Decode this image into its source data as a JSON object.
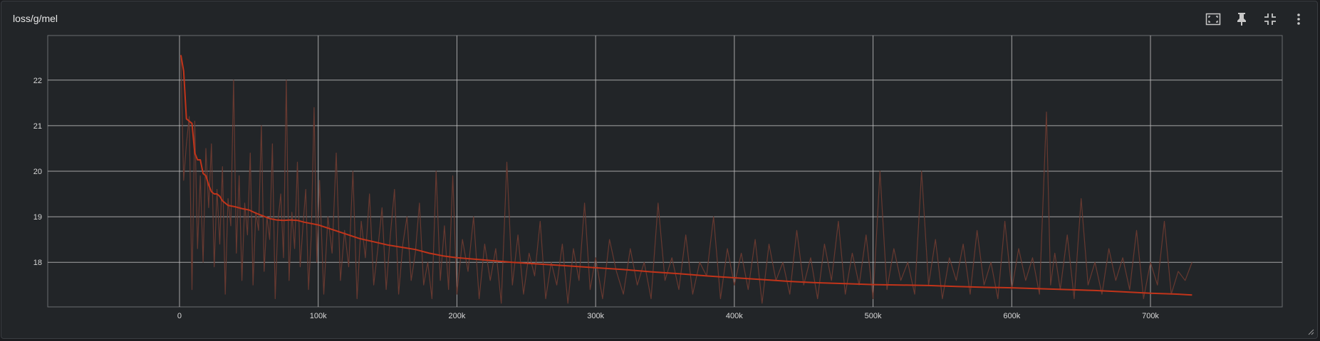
{
  "card": {
    "title": "loss/g/mel"
  },
  "toolbar": [
    {
      "name": "fit-domain-button",
      "icon": "fit-to-data-icon"
    },
    {
      "name": "pin-button",
      "icon": "pin-icon"
    },
    {
      "name": "collapse-button",
      "icon": "collapse-icon"
    },
    {
      "name": "more-options-button",
      "icon": "more-vert-icon"
    }
  ],
  "colors": {
    "background": "#222528",
    "grid": "#bcbcbc",
    "raw_series": "#6b3a30",
    "smoothed_series": "#c2341a",
    "tick_text": "#d8d8d8"
  },
  "chart_data": {
    "type": "line",
    "title": "loss/g/mel",
    "xlabel": "",
    "ylabel": "",
    "xlim": [
      -95000,
      795000
    ],
    "ylim": [
      17.02,
      22.98
    ],
    "x_ticks": [
      0,
      100000,
      200000,
      300000,
      400000,
      500000,
      600000,
      700000
    ],
    "x_tick_labels": [
      "0",
      "100k",
      "200k",
      "300k",
      "400k",
      "500k",
      "600k",
      "700k"
    ],
    "y_ticks": [
      18,
      19,
      20,
      21,
      22
    ],
    "y_tick_labels": [
      "18",
      "19",
      "20",
      "21",
      "22"
    ],
    "grid": true,
    "legend": "none",
    "series": [
      {
        "role": "raw",
        "color": "#6b3a30",
        "x": [
          1000,
          3000,
          5000,
          7000,
          9000,
          11000,
          13000,
          15000,
          17000,
          19000,
          21000,
          23000,
          25000,
          27000,
          29000,
          31000,
          33000,
          35000,
          37000,
          39000,
          41000,
          43000,
          45000,
          47000,
          49000,
          51000,
          53000,
          55000,
          57000,
          59000,
          61000,
          63000,
          65000,
          67000,
          69000,
          71000,
          73000,
          75000,
          77000,
          79000,
          81000,
          83000,
          85000,
          87000,
          89000,
          91000,
          93000,
          95000,
          97000,
          99000,
          101000,
          104000,
          107000,
          110000,
          113000,
          116000,
          119000,
          122000,
          125000,
          128000,
          131000,
          134000,
          137000,
          140000,
          143000,
          146000,
          149000,
          152000,
          155000,
          158000,
          161000,
          164000,
          167000,
          170000,
          173000,
          176000,
          179000,
          182000,
          185000,
          188000,
          191000,
          194000,
          197000,
          200000,
          204000,
          208000,
          212000,
          216000,
          220000,
          224000,
          228000,
          232000,
          236000,
          240000,
          244000,
          248000,
          252000,
          256000,
          260000,
          264000,
          268000,
          272000,
          276000,
          280000,
          284000,
          288000,
          292000,
          296000,
          300000,
          305000,
          310000,
          315000,
          320000,
          325000,
          330000,
          335000,
          340000,
          345000,
          350000,
          355000,
          360000,
          365000,
          370000,
          375000,
          380000,
          385000,
          390000,
          395000,
          400000,
          405000,
          410000,
          415000,
          420000,
          425000,
          430000,
          435000,
          440000,
          445000,
          450000,
          455000,
          460000,
          465000,
          470000,
          475000,
          480000,
          485000,
          490000,
          495000,
          500000,
          505000,
          510000,
          515000,
          520000,
          525000,
          530000,
          535000,
          540000,
          545000,
          550000,
          555000,
          560000,
          565000,
          570000,
          575000,
          580000,
          585000,
          590000,
          595000,
          600000,
          605000,
          610000,
          615000,
          620000,
          625000,
          628000,
          631000,
          635000,
          640000,
          645000,
          650000,
          655000,
          660000,
          665000,
          670000,
          675000,
          680000,
          685000,
          690000,
          695000,
          700000,
          705000,
          710000,
          715000,
          720000,
          725000,
          730000
        ],
        "y": [
          22.5,
          19.8,
          20.6,
          21.2,
          17.4,
          21.1,
          18.3,
          19.9,
          18.0,
          20.5,
          19.2,
          20.6,
          17.9,
          19.6,
          18.4,
          20.1,
          17.3,
          19.4,
          18.8,
          22.0,
          18.2,
          19.9,
          17.6,
          19.3,
          18.6,
          20.4,
          17.5,
          19.1,
          18.7,
          21.0,
          17.8,
          19.0,
          18.5,
          20.6,
          17.2,
          18.9,
          19.5,
          18.1,
          22.0,
          17.6,
          19.1,
          18.3,
          20.2,
          17.9,
          18.8,
          19.6,
          17.4,
          18.6,
          21.4,
          18.0,
          19.8,
          17.3,
          19.0,
          18.2,
          20.4,
          17.6,
          18.7,
          17.9,
          20.0,
          17.2,
          18.9,
          18.1,
          19.5,
          17.5,
          18.3,
          19.2,
          17.4,
          18.6,
          19.6,
          17.3,
          18.4,
          19.0,
          17.6,
          18.2,
          19.3,
          17.5,
          18.0,
          17.2,
          20.0,
          17.6,
          18.8,
          17.4,
          19.9,
          17.3,
          18.5,
          17.8,
          19.0,
          17.2,
          18.4,
          17.6,
          18.3,
          17.1,
          20.2,
          17.5,
          18.6,
          17.3,
          18.2,
          17.7,
          18.9,
          17.2,
          18.0,
          17.5,
          18.4,
          17.1,
          18.3,
          17.6,
          19.3,
          17.4,
          18.1,
          17.2,
          18.5,
          17.8,
          17.3,
          18.3,
          17.5,
          18.0,
          17.2,
          19.3,
          17.6,
          18.1,
          17.4,
          18.6,
          17.3,
          18.0,
          17.7,
          19.0,
          17.2,
          18.3,
          17.5,
          18.2,
          17.4,
          18.5,
          17.1,
          18.4,
          17.6,
          18.0,
          17.3,
          18.7,
          17.5,
          18.1,
          17.2,
          18.4,
          17.6,
          18.9,
          17.3,
          18.2,
          17.5,
          18.6,
          17.2,
          20.0,
          17.4,
          18.3,
          17.6,
          18.0,
          17.3,
          20.0,
          17.5,
          18.5,
          17.2,
          18.1,
          17.6,
          18.4,
          17.3,
          18.7,
          17.5,
          18.0,
          17.2,
          18.9,
          17.4,
          18.3,
          17.6,
          18.1,
          17.3,
          21.3,
          17.5,
          18.2,
          17.4,
          18.6,
          17.2,
          19.4,
          17.5,
          18.0,
          17.3,
          18.3,
          17.6,
          18.1,
          17.4,
          18.7,
          17.2,
          18.0,
          17.5,
          18.9,
          17.3,
          17.8,
          17.6,
          18.0
        ]
      },
      {
        "role": "smoothed",
        "color": "#c2341a",
        "x": [
          1000,
          3000,
          5000,
          7000,
          9000,
          11000,
          13000,
          15000,
          17000,
          19000,
          21000,
          23000,
          25000,
          27000,
          29000,
          31000,
          33000,
          35000,
          40000,
          45000,
          50000,
          55000,
          60000,
          65000,
          70000,
          75000,
          80000,
          85000,
          90000,
          95000,
          100000,
          110000,
          120000,
          130000,
          140000,
          150000,
          160000,
          170000,
          180000,
          190000,
          200000,
          220000,
          240000,
          260000,
          280000,
          300000,
          320000,
          340000,
          360000,
          380000,
          400000,
          420000,
          440000,
          460000,
          480000,
          500000,
          520000,
          540000,
          560000,
          580000,
          600000,
          620000,
          640000,
          660000,
          680000,
          700000,
          720000,
          730000
        ],
        "y": [
          22.55,
          22.2,
          21.15,
          21.1,
          21.05,
          20.4,
          20.25,
          20.25,
          19.95,
          19.9,
          19.7,
          19.55,
          19.5,
          19.5,
          19.45,
          19.35,
          19.3,
          19.25,
          19.22,
          19.18,
          19.15,
          19.08,
          19.02,
          18.96,
          18.93,
          18.92,
          18.93,
          18.92,
          18.88,
          18.85,
          18.82,
          18.72,
          18.62,
          18.52,
          18.45,
          18.38,
          18.33,
          18.28,
          18.2,
          18.14,
          18.1,
          18.05,
          18.0,
          17.96,
          17.92,
          17.88,
          17.84,
          17.79,
          17.75,
          17.7,
          17.66,
          17.62,
          17.58,
          17.55,
          17.53,
          17.51,
          17.5,
          17.49,
          17.47,
          17.45,
          17.44,
          17.42,
          17.4,
          17.38,
          17.35,
          17.32,
          17.3,
          17.28
        ]
      }
    ]
  }
}
